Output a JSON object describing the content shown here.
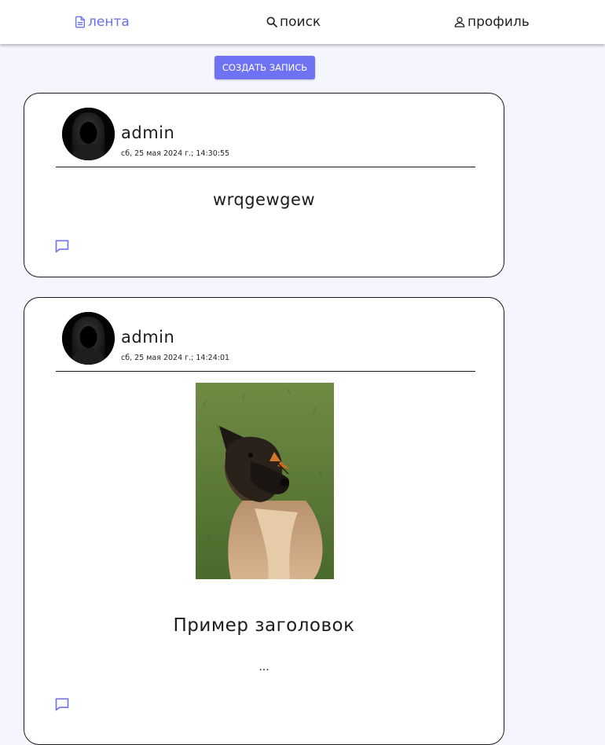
{
  "nav": {
    "feed": {
      "label": "лента",
      "icon": "document-icon",
      "active": true
    },
    "search": {
      "label": "поиск",
      "icon": "search-icon"
    },
    "profile": {
      "label": "профиль",
      "icon": "user-icon"
    }
  },
  "create_button_label": "СОЗДАТЬ ЗАПИСЬ",
  "colors": {
    "accent": "#6f73f3",
    "background": "#f4f5fd"
  },
  "posts": [
    {
      "author": "admin",
      "date": "сб, 25 мая 2024 г.; 14:30:55",
      "text": "wrqgewgew",
      "comment_icon": "comment-icon"
    },
    {
      "author": "admin",
      "date": "сб, 25 мая 2024 г.; 14:24:01",
      "image": "photo of a dog with a butterfly on its nose",
      "title": "Пример заголовок",
      "excerpt": "...",
      "comment_icon": "comment-icon"
    }
  ]
}
